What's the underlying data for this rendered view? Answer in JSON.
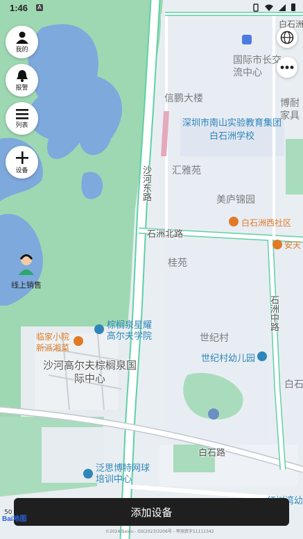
{
  "status_bar": {
    "time": "1:46"
  },
  "left_controls": [
    {
      "label": "我的",
      "icon": "person-icon"
    },
    {
      "label": "报警",
      "icon": "bell-icon"
    },
    {
      "label": "列表",
      "icon": "list-icon"
    },
    {
      "label": "设备",
      "icon": "plus-icon"
    }
  ],
  "right_controls": {
    "layers_icon": "globe-icon",
    "more_icon": "ellipsis-icon"
  },
  "sales_label": "线上销售",
  "map": {
    "roads": {
      "shahe_east": "沙河东路",
      "baishizhou_north": "石洲北路",
      "baishizhou_middle": "石洲中路",
      "baishi_road": "白石路",
      "top_right": "白石洲"
    },
    "districts": {
      "intl_center": "国际市长交流中心",
      "xinpeng": "信鹏大楼",
      "school": "深圳市南山实验教育集团白石洲学校",
      "huiya": "汇雅苑",
      "meilu": "美庐锦园",
      "gui": "桂苑",
      "century": "世纪村",
      "golf_center": "沙河高尔夫棕榈泉国际中心",
      "bofu": "博耐家具",
      "baishi_cut": "白石"
    },
    "pois": {
      "baishizhou_west": "白石洲西社区",
      "anyang": "安天",
      "xinjia": "临家小院新派湘菜",
      "golf_academy": "棕榈泉星耀高尔夫学院",
      "kindergarten": "世纪村幼儿园",
      "tennis": "泛思博特网球培训中心",
      "bottom_cut": "红树湾幼"
    },
    "scale": "50",
    "copyright": "©2024 Baidu - GS(2023)3206号 - 甲测资字11111342"
  },
  "add_button": {
    "label": "添加设备"
  },
  "logo": "Bai地图",
  "colors": {
    "park": "#9ed8b3",
    "water": "#7ea9dd",
    "city": "#e9eef3",
    "road": "#ffffff",
    "road_edge": "#5ed1a4",
    "button": "#1f1f1f"
  }
}
